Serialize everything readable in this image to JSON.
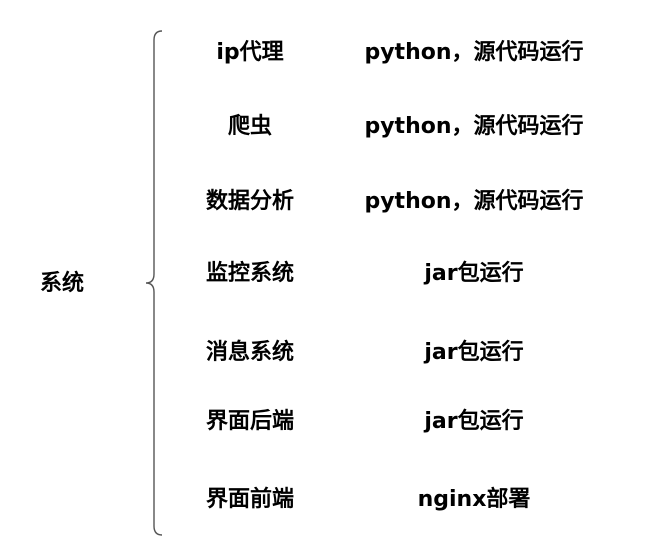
{
  "root": {
    "label": "系统"
  },
  "rows": [
    {
      "name": "ip代理",
      "method": "python，源代码运行"
    },
    {
      "name": "爬虫",
      "method": "python，源代码运行"
    },
    {
      "name": "数据分析",
      "method": "python，源代码运行"
    },
    {
      "name": "监控系统",
      "method": "jar包运行"
    },
    {
      "name": "消息系统",
      "method": "jar包运行"
    },
    {
      "name": "界面后端",
      "method": "jar包运行"
    },
    {
      "name": "界面前端",
      "method": "nginx部署"
    }
  ],
  "colors": {
    "text": "#000000",
    "brace": "#555555",
    "background": "#ffffff"
  }
}
